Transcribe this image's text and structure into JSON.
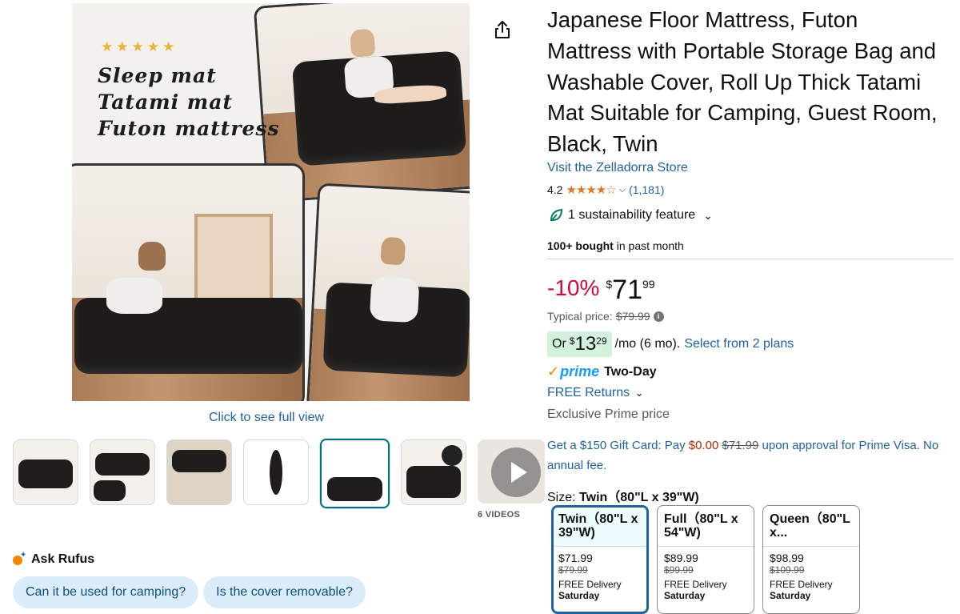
{
  "gallery": {
    "promo_lines": [
      "Sleep mat",
      "Tatami mat",
      "Futon mattress"
    ],
    "click_full_view": "Click to see full view",
    "videos_label": "6 VIDEOS"
  },
  "rufus": {
    "title": "Ask Rufus",
    "chips": [
      "Can it be used for camping?",
      "Is the cover removable?"
    ]
  },
  "product": {
    "title": "Japanese Floor Mattress, Futon Mattress with Portable Storage Bag and Washable Cover, Roll Up Thick Tatami Mat Suitable for Camping, Guest Room, Black, Twin",
    "store_link": "Visit the Zelladorra Store",
    "rating": "4.2",
    "rating_count": "(1,181)",
    "sustainability": "1 sustainability feature",
    "bought_bold": "100+ bought",
    "bought_rest": "in past month"
  },
  "price": {
    "discount": "-10%",
    "currency": "$",
    "whole": "71",
    "fraction": "99",
    "typical_label": "Typical price:",
    "typical_value": "$79.99",
    "monthly_or": "Or",
    "monthly_currency": "$",
    "monthly_whole": "13",
    "monthly_fraction": "29",
    "monthly_suffix": "/mo (6 mo).",
    "plans_link": "Select from 2 plans"
  },
  "delivery": {
    "prime": "prime",
    "two_day": "Two-Day",
    "returns": "FREE Returns",
    "exclusive": "Exclusive Prime price"
  },
  "giftcard": {
    "part1": "Get a $150 Gift Card: Pay",
    "pay_now": "$0.00",
    "old": "$71.99",
    "part2": "upon approval for Prime Visa. No annual fee."
  },
  "size": {
    "label": "Size:",
    "selected": "Twin（80\"L x 39\"W)",
    "options": [
      {
        "name": "Twin（80\"L x 39\"W)",
        "price": "$71.99",
        "old": "$79.99",
        "delivery": "FREE Delivery",
        "day": "Saturday"
      },
      {
        "name": "Full（80\"L x 54\"W)",
        "price": "$89.99",
        "old": "$99.99",
        "delivery": "FREE Delivery",
        "day": "Saturday"
      },
      {
        "name": "Queen（80\"L x...",
        "price": "$98.99",
        "old": "$109.99",
        "delivery": "FREE Delivery",
        "day": "Saturday"
      }
    ]
  },
  "colors": {
    "link": "#2162a1",
    "deal_red": "#cc0c39",
    "star": "#de7921",
    "prime_blue": "#1a98ff"
  }
}
